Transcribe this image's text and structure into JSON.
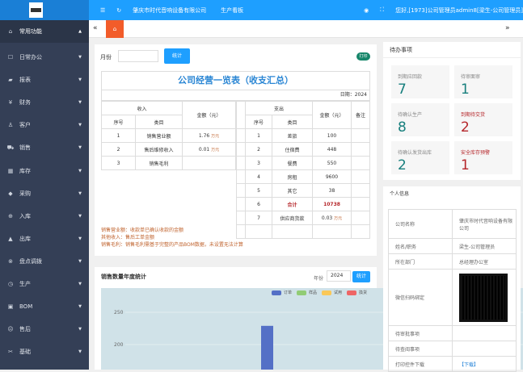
{
  "header": {
    "company": "肇庆市时代音响设备有限公司",
    "board": "生产看板",
    "greeting": "您好,[1973]公司管理员admin8[梁生-公司管理员]"
  },
  "sidebar": [
    {
      "icon": "⌂",
      "label": "常用功能"
    },
    {
      "icon": "☐",
      "label": "日常办公"
    },
    {
      "icon": "▰",
      "label": "报表"
    },
    {
      "icon": "¥",
      "label": "财务"
    },
    {
      "icon": "♙",
      "label": "客户"
    },
    {
      "icon": "⛟",
      "label": "销售"
    },
    {
      "icon": "▦",
      "label": "库存"
    },
    {
      "icon": "◆",
      "label": "采购"
    },
    {
      "icon": "⊕",
      "label": "入库"
    },
    {
      "icon": "▲",
      "label": "出库"
    },
    {
      "icon": "⊗",
      "label": "盘点调拨"
    },
    {
      "icon": "◷",
      "label": "生产"
    },
    {
      "icon": "▣",
      "label": "BOM"
    },
    {
      "icon": "☹",
      "label": "售后"
    },
    {
      "icon": "✂",
      "label": "基础"
    }
  ],
  "filter": {
    "month_label": "月份",
    "month_value": "",
    "stat_button": "统计",
    "print": "打印"
  },
  "summary": {
    "title": "公司经营一览表（收支汇总）",
    "date": "日期：2024",
    "income": "收入",
    "expense": "支出",
    "amount": "金额（元）",
    "remark": "备注",
    "seq": "序号",
    "cat": "类目",
    "unit": "万元",
    "income_rows": [
      {
        "n": "1",
        "c": "销售营业额",
        "v": "1.76"
      },
      {
        "n": "2",
        "c": "售后维修收入",
        "v": "0.01"
      },
      {
        "n": "3",
        "c": "销售毛利",
        "v": ""
      }
    ],
    "expense_rows": [
      {
        "n": "1",
        "c": "差旅",
        "v": "100"
      },
      {
        "n": "2",
        "c": "住宿费",
        "v": "448"
      },
      {
        "n": "3",
        "c": "餐费",
        "v": "550"
      },
      {
        "n": "4",
        "c": "房租",
        "v": "9600"
      },
      {
        "n": "5",
        "c": "其它",
        "v": "38"
      },
      {
        "n": "6",
        "c": "合计",
        "v": "10738"
      },
      {
        "n": "7",
        "c": "供应商货款",
        "v": "0.03"
      }
    ],
    "notes": [
      "销售营业额：收款单已确认收款的金额",
      "其他收入：售后工单金额",
      "销售毛利：销售毛利需基于完整的产品BOM数据，未设置无法计算"
    ]
  },
  "sales_chart": {
    "title": "销售数量年度统计",
    "year_label": "年份",
    "year": "2024",
    "button": "统计"
  },
  "chart_data": {
    "type": "bar",
    "title": "销售数量年度统计",
    "legend": [
      "订单",
      "样品",
      "试用",
      "換货"
    ],
    "colors": [
      "#5470c6",
      "#91cc75",
      "#fac858",
      "#ee6666"
    ],
    "yticks": [
      200,
      250
    ],
    "series": [
      {
        "name": "订单",
        "values": [
          229
        ]
      }
    ],
    "legend_position": "top-right"
  },
  "todo": {
    "title": "待办事项",
    "items": [
      {
        "label": "到期应回款",
        "value": "7",
        "alert": false
      },
      {
        "label": "待审面审",
        "value": "1",
        "alert": false
      },
      {
        "label": "待确认生产",
        "value": "8",
        "alert": false
      },
      {
        "label": "到期待交货",
        "value": "2",
        "alert": true
      },
      {
        "label": "待确认发货出库",
        "value": "2",
        "alert": false
      },
      {
        "label": "安全库存预警",
        "value": "1",
        "alert": true
      }
    ]
  },
  "info": {
    "title": "个人信息",
    "rows": [
      {
        "k": "公司名称",
        "v": "肇庆市时代音响设备有限公司"
      },
      {
        "k": "姓名/职务",
        "v": "梁生-公司管理员"
      },
      {
        "k": "所在部门",
        "v": "总经理办公室"
      },
      {
        "k": "微信扫码绑定",
        "v": ""
      },
      {
        "k": "待审批事项",
        "v": ""
      },
      {
        "k": "待查阅事项",
        "v": ""
      },
      {
        "k": "打印控件下载",
        "v": "【下载】"
      }
    ]
  }
}
